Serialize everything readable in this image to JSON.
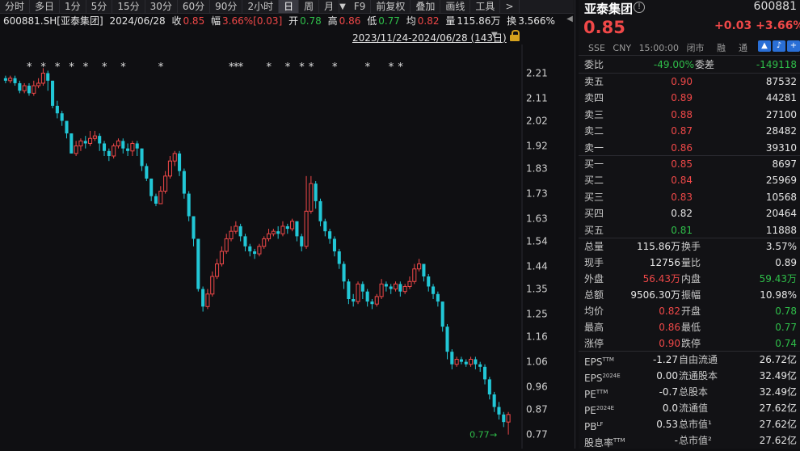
{
  "toolbar": {
    "items": [
      "分时",
      "多日",
      "1分",
      "5分",
      "15分",
      "30分",
      "60分",
      "90分",
      "2小时",
      "日",
      "周",
      "月",
      "F9",
      "前复权",
      "叠加",
      "画线",
      "工具",
      ">"
    ],
    "active_index": 9
  },
  "info": {
    "symbol": "600881.SH[亚泰集团]",
    "date": "2024/06/28",
    "close_label": "收",
    "close": "0.85",
    "amp_label": "幅",
    "amp": "3.66%[0.03]",
    "open_label": "开",
    "open": "0.78",
    "high_label": "高",
    "high": "0.86",
    "low_label": "低",
    "low": "0.77",
    "avg_label": "均",
    "avg": "0.82",
    "vol_label": "量",
    "vol": "115.86万",
    "turn_label": "换",
    "turn": "3.566%"
  },
  "range": {
    "text": "2023/11/24-2024/06/28 (143日)"
  },
  "chart_data": {
    "type": "candlestick",
    "y_ticks": [
      "2.21",
      "2.11",
      "2.02",
      "1.92",
      "1.83",
      "1.73",
      "1.63",
      "1.54",
      "1.44",
      "1.35",
      "1.25",
      "1.16",
      "1.06",
      "0.96",
      "0.87",
      "0.77"
    ],
    "ylim": [
      0.74,
      2.26
    ],
    "low_marker": "0.77",
    "star_positions": [
      5,
      8,
      11,
      14,
      17,
      21,
      25,
      33,
      48,
      49,
      50,
      56,
      60,
      63,
      65,
      70,
      77,
      82,
      84
    ],
    "bars": [
      [
        2.19,
        2.18,
        2.2,
        2.17
      ],
      [
        2.18,
        2.19,
        2.2,
        2.17
      ],
      [
        2.19,
        2.17,
        2.2,
        2.16
      ],
      [
        2.17,
        2.14,
        2.18,
        2.13
      ],
      [
        2.14,
        2.16,
        2.17,
        2.13
      ],
      [
        2.16,
        2.13,
        2.17,
        2.12
      ],
      [
        2.13,
        2.16,
        2.18,
        2.12
      ],
      [
        2.16,
        2.17,
        2.19,
        2.15
      ],
      [
        2.17,
        2.21,
        2.23,
        2.16
      ],
      [
        2.21,
        2.18,
        2.22,
        2.14
      ],
      [
        2.18,
        2.08,
        2.18,
        2.07
      ],
      [
        2.08,
        2.05,
        2.1,
        2.03
      ],
      [
        2.05,
        2.02,
        2.06,
        2.0
      ],
      [
        2.02,
        1.97,
        2.02,
        1.95
      ],
      [
        1.97,
        1.89,
        1.97,
        1.89
      ],
      [
        1.89,
        1.92,
        1.94,
        1.88
      ],
      [
        1.92,
        1.94,
        1.95,
        1.9
      ],
      [
        1.94,
        1.93,
        1.96,
        1.91
      ],
      [
        1.93,
        1.95,
        1.98,
        1.92
      ],
      [
        1.95,
        1.96,
        1.98,
        1.94
      ],
      [
        1.96,
        1.93,
        1.97,
        1.9
      ],
      [
        1.93,
        1.9,
        1.94,
        1.88
      ],
      [
        1.9,
        1.88,
        1.91,
        1.86
      ],
      [
        1.88,
        1.92,
        1.93,
        1.87
      ],
      [
        1.92,
        1.94,
        1.95,
        1.91
      ],
      [
        1.94,
        1.91,
        1.95,
        1.89
      ],
      [
        1.91,
        1.9,
        1.93,
        1.88
      ],
      [
        1.9,
        1.93,
        1.94,
        1.88
      ],
      [
        1.93,
        1.91,
        1.94,
        1.88
      ],
      [
        1.91,
        1.84,
        1.91,
        1.82
      ],
      [
        1.84,
        1.79,
        1.85,
        1.78
      ],
      [
        1.79,
        1.72,
        1.79,
        1.7
      ],
      [
        1.72,
        1.69,
        1.73,
        1.68
      ],
      [
        1.69,
        1.74,
        1.76,
        1.69
      ],
      [
        1.74,
        1.8,
        1.82,
        1.73
      ],
      [
        1.8,
        1.86,
        1.88,
        1.79
      ],
      [
        1.86,
        1.89,
        1.9,
        1.84
      ],
      [
        1.89,
        1.82,
        1.9,
        1.8
      ],
      [
        1.82,
        1.73,
        1.83,
        1.71
      ],
      [
        1.73,
        1.64,
        1.74,
        1.62
      ],
      [
        1.64,
        1.55,
        1.64,
        1.52
      ],
      [
        1.55,
        1.35,
        1.55,
        1.34
      ],
      [
        1.35,
        1.28,
        1.36,
        1.26
      ],
      [
        1.28,
        1.33,
        1.35,
        1.27
      ],
      [
        1.33,
        1.4,
        1.42,
        1.32
      ],
      [
        1.4,
        1.45,
        1.47,
        1.39
      ],
      [
        1.45,
        1.5,
        1.52,
        1.44
      ],
      [
        1.5,
        1.55,
        1.57,
        1.49
      ],
      [
        1.55,
        1.58,
        1.6,
        1.54
      ],
      [
        1.58,
        1.6,
        1.62,
        1.57
      ],
      [
        1.6,
        1.56,
        1.61,
        1.54
      ],
      [
        1.56,
        1.52,
        1.57,
        1.5
      ],
      [
        1.52,
        1.5,
        1.53,
        1.48
      ],
      [
        1.5,
        1.49,
        1.51,
        1.47
      ],
      [
        1.49,
        1.52,
        1.53,
        1.48
      ],
      [
        1.52,
        1.55,
        1.56,
        1.51
      ],
      [
        1.55,
        1.57,
        1.59,
        1.54
      ],
      [
        1.57,
        1.58,
        1.59,
        1.56
      ],
      [
        1.58,
        1.57,
        1.6,
        1.55
      ],
      [
        1.57,
        1.6,
        1.62,
        1.56
      ],
      [
        1.6,
        1.59,
        1.61,
        1.57
      ],
      [
        1.59,
        1.62,
        1.63,
        1.58
      ],
      [
        1.62,
        1.56,
        1.62,
        1.54
      ],
      [
        1.56,
        1.52,
        1.57,
        1.5
      ],
      [
        1.52,
        1.66,
        1.8,
        1.51
      ],
      [
        1.66,
        1.77,
        1.8,
        1.65
      ],
      [
        1.77,
        1.7,
        1.78,
        1.67
      ],
      [
        1.7,
        1.62,
        1.71,
        1.6
      ],
      [
        1.62,
        1.58,
        1.63,
        1.56
      ],
      [
        1.58,
        1.55,
        1.59,
        1.53
      ],
      [
        1.55,
        1.5,
        1.56,
        1.48
      ],
      [
        1.5,
        1.45,
        1.51,
        1.43
      ],
      [
        1.45,
        1.38,
        1.46,
        1.35
      ],
      [
        1.38,
        1.31,
        1.39,
        1.29
      ],
      [
        1.31,
        1.3,
        1.33,
        1.28
      ],
      [
        1.3,
        1.37,
        1.38,
        1.29
      ],
      [
        1.37,
        1.34,
        1.38,
        1.31
      ],
      [
        1.34,
        1.3,
        1.35,
        1.28
      ],
      [
        1.3,
        1.29,
        1.31,
        1.27
      ],
      [
        1.29,
        1.32,
        1.33,
        1.28
      ],
      [
        1.32,
        1.37,
        1.39,
        1.31
      ],
      [
        1.37,
        1.36,
        1.38,
        1.34
      ],
      [
        1.36,
        1.35,
        1.37,
        1.33
      ],
      [
        1.35,
        1.37,
        1.38,
        1.34
      ],
      [
        1.37,
        1.34,
        1.38,
        1.32
      ],
      [
        1.34,
        1.36,
        1.37,
        1.33
      ],
      [
        1.36,
        1.38,
        1.4,
        1.35
      ],
      [
        1.38,
        1.43,
        1.45,
        1.37
      ],
      [
        1.43,
        1.45,
        1.47,
        1.42
      ],
      [
        1.45,
        1.4,
        1.45,
        1.38
      ],
      [
        1.4,
        1.36,
        1.41,
        1.34
      ],
      [
        1.36,
        1.33,
        1.37,
        1.31
      ],
      [
        1.33,
        1.3,
        1.34,
        1.28
      ],
      [
        1.3,
        1.2,
        1.3,
        1.18
      ],
      [
        1.2,
        1.1,
        1.21,
        1.07
      ],
      [
        1.1,
        1.05,
        1.11,
        1.03
      ],
      [
        1.05,
        1.07,
        1.08,
        1.04
      ],
      [
        1.07,
        1.06,
        1.08,
        1.05
      ],
      [
        1.06,
        1.05,
        1.07,
        1.04
      ],
      [
        1.05,
        1.07,
        1.08,
        1.04
      ],
      [
        1.07,
        1.05,
        1.08,
        1.03
      ],
      [
        1.05,
        1.04,
        1.06,
        1.02
      ],
      [
        1.04,
        0.99,
        1.05,
        0.97
      ],
      [
        0.99,
        0.93,
        1.0,
        0.91
      ],
      [
        0.93,
        0.88,
        0.94,
        0.86
      ],
      [
        0.88,
        0.85,
        0.9,
        0.83
      ],
      [
        0.85,
        0.82,
        0.86,
        0.8
      ],
      [
        0.82,
        0.85,
        0.86,
        0.77
      ]
    ]
  },
  "panel": {
    "name": "亚泰集团",
    "code": "600881",
    "price": "0.85",
    "change": "+0.03 +3.66%",
    "meta": [
      "SSE",
      "CNY",
      "15:00:00",
      "闭市"
    ],
    "rong": "融",
    "tong": "通",
    "weibi_label": "委比",
    "weibi": "-49.00%",
    "weicha_label": "委差",
    "weicha": "-149118",
    "sells": [
      {
        "label": "卖五",
        "price": "0.90",
        "vol": "87532"
      },
      {
        "label": "卖四",
        "price": "0.89",
        "vol": "44281"
      },
      {
        "label": "卖三",
        "price": "0.88",
        "vol": "27100"
      },
      {
        "label": "卖二",
        "price": "0.87",
        "vol": "28482"
      },
      {
        "label": "卖一",
        "price": "0.86",
        "vol": "39310"
      }
    ],
    "buys": [
      {
        "label": "买一",
        "price": "0.85",
        "vol": "8697"
      },
      {
        "label": "买二",
        "price": "0.84",
        "vol": "25969"
      },
      {
        "label": "买三",
        "price": "0.83",
        "vol": "10568"
      },
      {
        "label": "买四",
        "price": "0.82",
        "vol": "20464"
      },
      {
        "label": "买五",
        "price": "0.81",
        "vol": "11888"
      }
    ],
    "stats": [
      {
        "l1": "总量",
        "v1": "115.86万",
        "l2": "换手",
        "v2": "3.57%",
        "c1": "white",
        "c2": "white"
      },
      {
        "l1": "现手",
        "v1": "12756",
        "l2": "量比",
        "v2": "0.89",
        "c1": "white",
        "c2": "white"
      },
      {
        "l1": "外盘",
        "v1": "56.43万",
        "l2": "内盘",
        "v2": "59.43万",
        "c1": "red",
        "c2": "green"
      },
      {
        "l1": "总额",
        "v1": "9506.30万",
        "l2": "振幅",
        "v2": "10.98%",
        "c1": "white",
        "c2": "white"
      },
      {
        "l1": "均价",
        "v1": "0.82",
        "l2": "开盘",
        "v2": "0.78",
        "c1": "red",
        "c2": "green"
      },
      {
        "l1": "最高",
        "v1": "0.86",
        "l2": "最低",
        "v2": "0.77",
        "c1": "red",
        "c2": "green"
      },
      {
        "l1": "涨停",
        "v1": "0.90",
        "l2": "跌停",
        "v2": "0.74",
        "c1": "red",
        "c2": "green"
      }
    ],
    "fin": [
      {
        "l1": "EPS",
        "s1": "TTM",
        "v1": "-1.27",
        "l2": "自由流通",
        "v2": "26.72亿"
      },
      {
        "l1": "EPS",
        "s1": "2024E",
        "v1": "0.00",
        "l2": "流通股本",
        "v2": "32.49亿"
      },
      {
        "l1": "PE",
        "s1": "TTM",
        "v1": "-0.7",
        "l2": "总股本",
        "v2": "32.49亿"
      },
      {
        "l1": "PE",
        "s1": "2024E",
        "v1": "0.0",
        "l2": "流通值",
        "v2": "27.62亿"
      },
      {
        "l1": "PB",
        "s1": "LF",
        "v1": "0.53",
        "l2": "总市值¹",
        "v2": "27.62亿"
      },
      {
        "l1": "股息率",
        "s1": "TTM",
        "v1": "-",
        "l2": "总市值²",
        "v2": "27.62亿"
      }
    ]
  }
}
